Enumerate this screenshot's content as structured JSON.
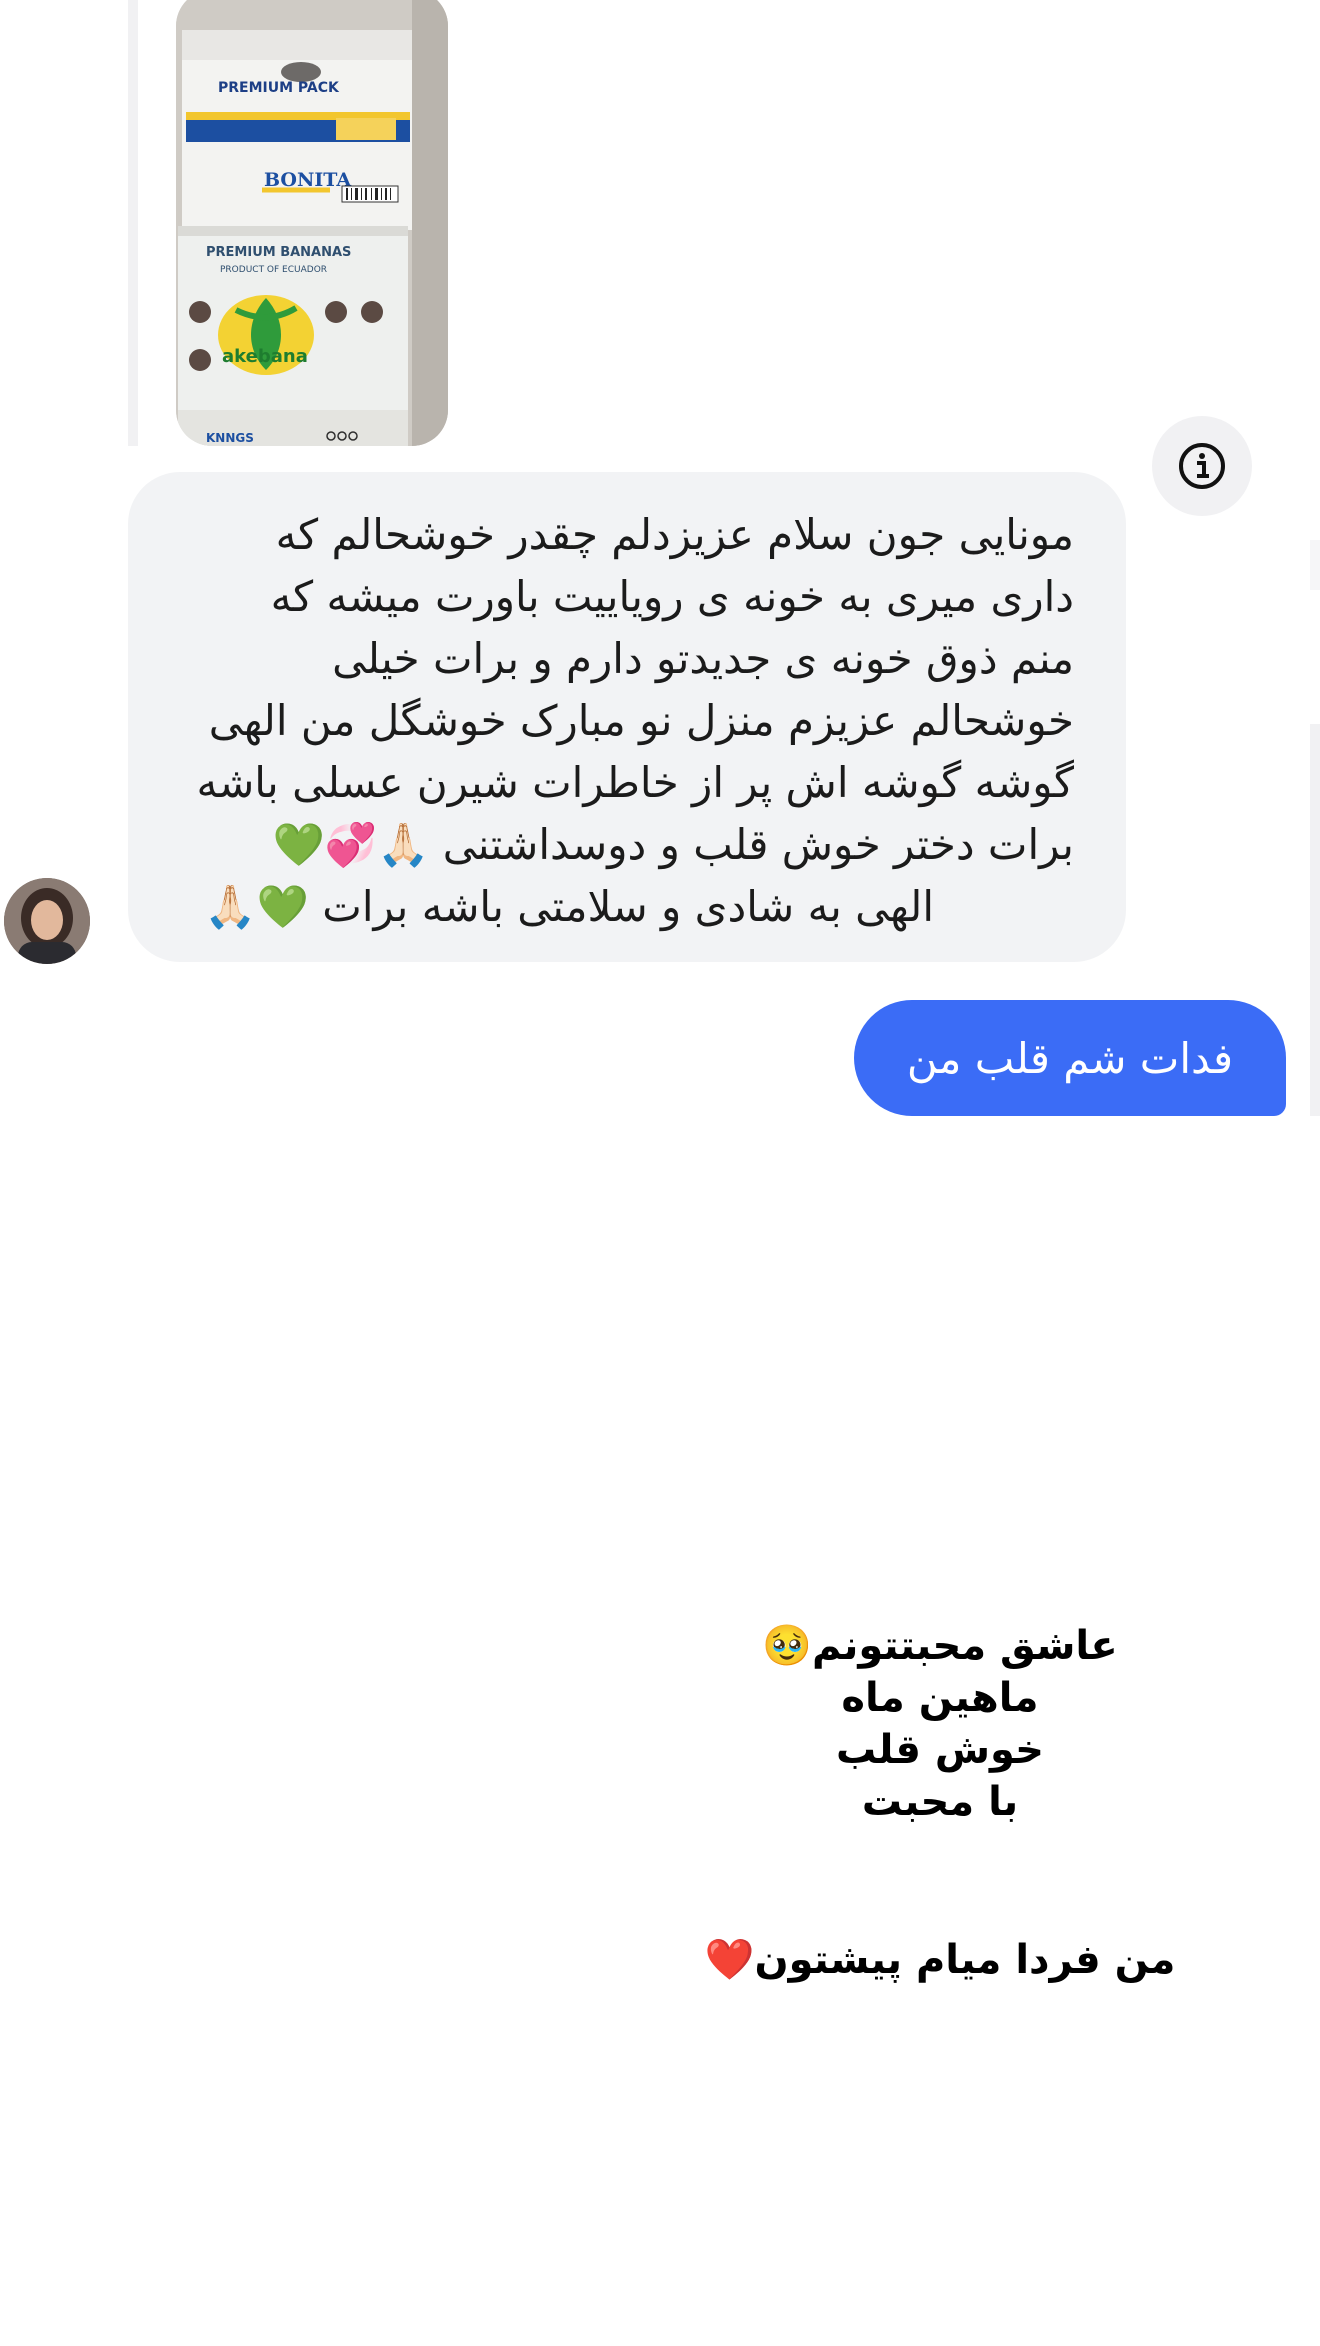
{
  "thread": {
    "photo_text": {
      "box_top": "PREMIUM PACK",
      "brand_top": "BONITA",
      "box_bottom": "PREMIUM BANANAS",
      "box_bottom_sub": "PRODUCT OF ECUADOR",
      "brand_bottom": "akebana"
    },
    "info_icon": "info-icon",
    "incoming_message": {
      "lines": [
        "مونایی جون سلام عزیزدلم چقدر خوشحالم که",
        "داری میری به خونه ی رویاییت باورت میشه که",
        "منم ذوق  خونه ی جدیدتو دارم و برات خیلی",
        "خوشحالم عزیزم منزل نو مبارک خوشگل من الهی",
        "گوشه گوشه اش پر از خاطرات شیرن عسلی باشه",
        "برات دختر خوش قلب و دوسداشتنی 🙏🏻💞💚",
        "الهی به شادی و سلامتی باشه برات 💚🙏🏻"
      ]
    },
    "outgoing_message": "فدات شم قلب من"
  },
  "story": {
    "lines": [
      "عاشق محبتتونم🥹",
      "ماهین ماه",
      "خوش قلب",
      "با محبت"
    ],
    "line2": "من فردا میام پیشتون❤️"
  },
  "colors": {
    "outgoing_bubble": "#3b6cf6",
    "incoming_bubble": "#f2f3f5",
    "thread_line": "#f1f1f3"
  }
}
